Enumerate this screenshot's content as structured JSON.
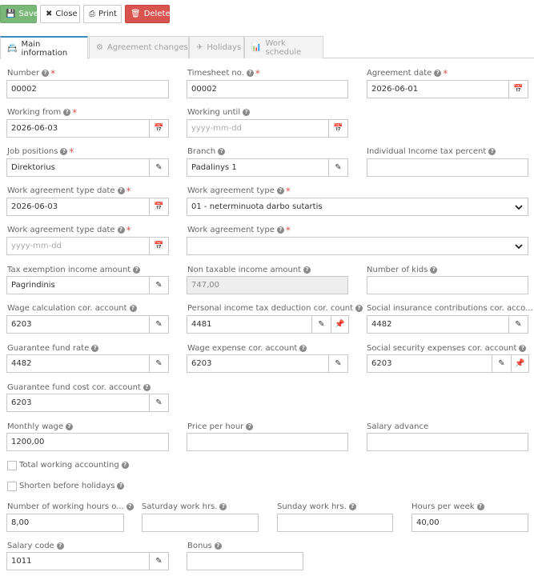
{
  "toolbar": {
    "save": "Save",
    "close": "Close",
    "print": "Print",
    "delete": "Delete"
  },
  "tabs": {
    "main": "Main information",
    "changes": "Agreement changes",
    "holidays": "Holidays",
    "schedule": "Work schedule"
  },
  "fields": {
    "number": {
      "label": "Number",
      "value": "00002"
    },
    "timesheet_no": {
      "label": "Timesheet no.",
      "value": "00002"
    },
    "agreement_date": {
      "label": "Agreement date",
      "value": "2026-06-01"
    },
    "working_from": {
      "label": "Working from",
      "value": "2026-06-03"
    },
    "working_until": {
      "label": "Working until",
      "placeholder": "yyyy-mm-dd"
    },
    "job_positions": {
      "label": "Job positions",
      "value": "Direktorius"
    },
    "branch": {
      "label": "Branch",
      "value": "Padalinys 1"
    },
    "income_tax_percent": {
      "label": "Individual Income tax percent",
      "value": ""
    },
    "agreement_type_date_1": {
      "label": "Work agreement type date",
      "value": "2026-06-03"
    },
    "agreement_type_1": {
      "label": "Work agreement type",
      "value": "01 - neterminuota darbo sutartis"
    },
    "agreement_type_date_2": {
      "label": "Work agreement type date",
      "placeholder": "yyyy-mm-dd"
    },
    "agreement_type_2": {
      "label": "Work agreement type",
      "value": ""
    },
    "tax_exemption": {
      "label": "Tax exemption income amount",
      "value": "Pagrindinis"
    },
    "non_taxable": {
      "label": "Non taxable income amount",
      "value": "747,00"
    },
    "kids": {
      "label": "Number of kids",
      "value": ""
    },
    "wage_calc_account": {
      "label": "Wage calculation cor. account",
      "value": "6203"
    },
    "pit_deduction_account": {
      "label": "Personal income tax deduction cor. count",
      "value": "4481"
    },
    "social_insurance_account": {
      "label": "Social insurance contributions cor. acco...",
      "value": "4482"
    },
    "guarantee_fund_rate": {
      "label": "Guarantee fund rate",
      "value": "4482"
    },
    "wage_expense_account": {
      "label": "Wage expense cor. account",
      "value": "6203"
    },
    "social_security_account": {
      "label": "Social security expenses cor. account",
      "value": "6203"
    },
    "guarantee_fund_cost": {
      "label": "Guarantee fund cost cor. account",
      "value": "6203"
    },
    "monthly_wage": {
      "label": "Monthly wage",
      "value": "1200,00"
    },
    "price_per_hour": {
      "label": "Price per hour",
      "value": ""
    },
    "salary_advance": {
      "label": "Salary advance",
      "value": ""
    },
    "total_working": {
      "label": "Total working accounting"
    },
    "shorten_holidays": {
      "label": "Shorten before holidays"
    },
    "working_hours": {
      "label": "Number of working hours o...",
      "value": "8,00"
    },
    "saturday_hrs": {
      "label": "Saturday work hrs.",
      "value": ""
    },
    "sunday_hrs": {
      "label": "Sunday work hrs.",
      "value": ""
    },
    "hours_per_week": {
      "label": "Hours per week",
      "value": "40,00"
    },
    "salary_code": {
      "label": "Salary code",
      "value": "1011"
    },
    "bonus": {
      "label": "Bonus",
      "value": ""
    }
  },
  "icons": {
    "calendar": "calendar-icon",
    "edit": "pencil-icon",
    "pin": "pin-icon",
    "help": "question-icon",
    "dropdown": "chevron-down-icon"
  },
  "colors": {
    "save": "#7ab87a",
    "delete": "#d9534f",
    "active_tab": "#3c8dbc",
    "required": "#d9534f"
  }
}
